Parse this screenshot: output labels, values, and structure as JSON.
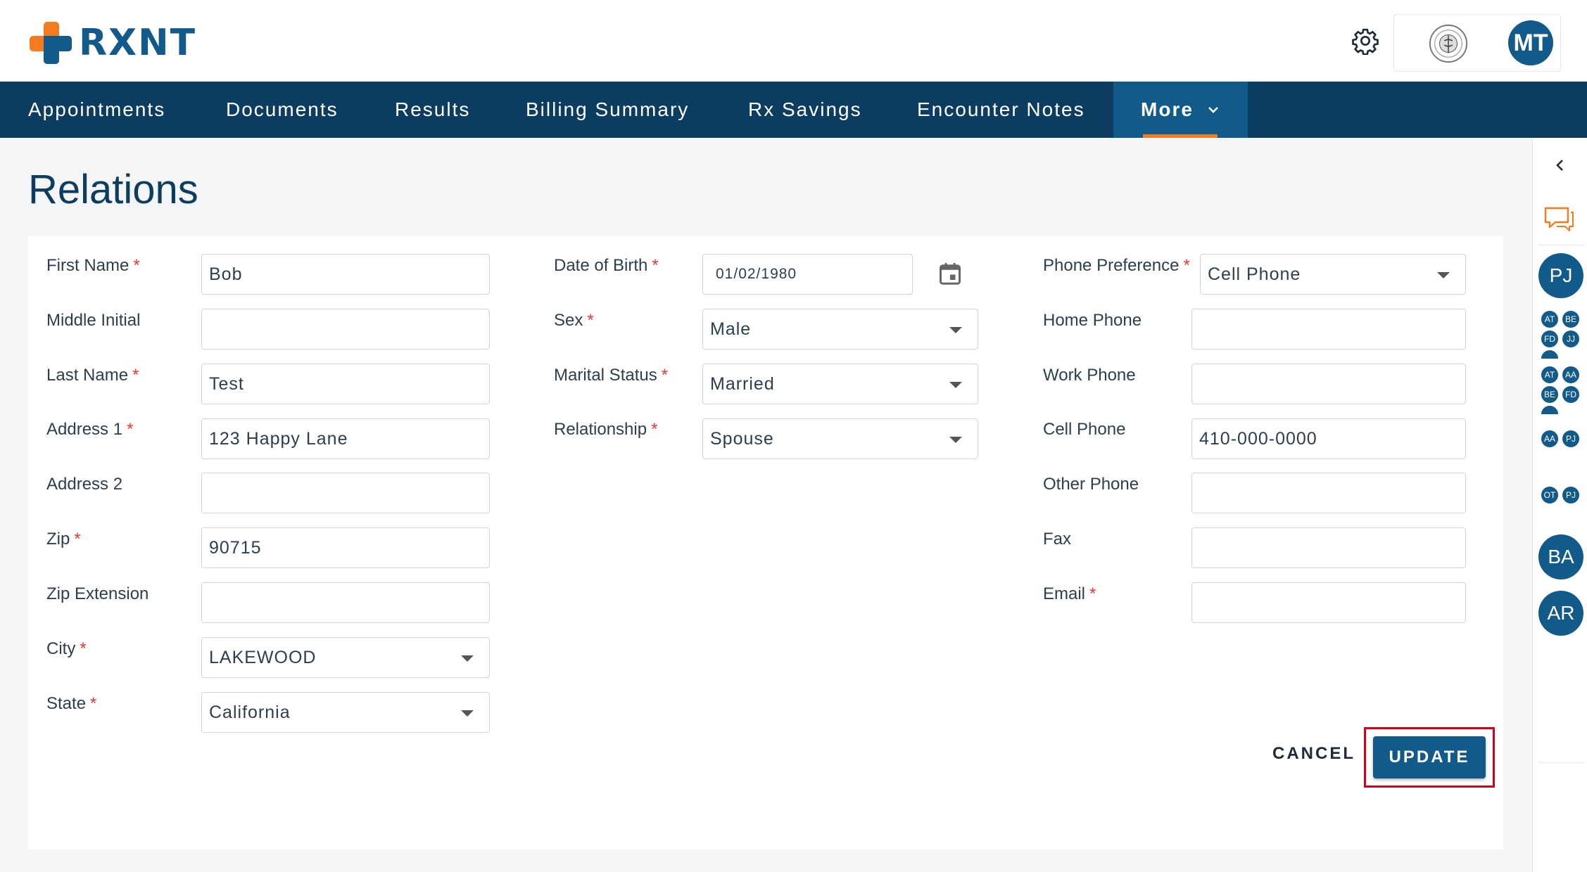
{
  "header": {
    "logo_text": "RXNT",
    "user_initials": "MT",
    "brand_colors": {
      "primary": "#115a8a",
      "nav": "#0c3d60",
      "accent": "#f47b20",
      "required": "#e53935",
      "highlight": "#d0021b"
    }
  },
  "nav": {
    "items": [
      "Appointments",
      "Documents",
      "Results",
      "Billing Summary",
      "Rx Savings",
      "Encounter Notes"
    ],
    "more_label": "More"
  },
  "page": {
    "title": "Relations"
  },
  "form": {
    "col1": [
      {
        "label": "First Name",
        "required": true,
        "value": "Bob",
        "type": "text"
      },
      {
        "label": "Middle Initial",
        "required": false,
        "value": "",
        "type": "text"
      },
      {
        "label": "Last Name",
        "required": true,
        "value": "Test",
        "type": "text"
      },
      {
        "label": "Address 1",
        "required": true,
        "value": "123 Happy Lane",
        "type": "text"
      },
      {
        "label": "Address 2",
        "required": false,
        "value": "",
        "type": "text"
      },
      {
        "label": "Zip",
        "required": true,
        "value": "90715",
        "type": "text"
      },
      {
        "label": "Zip Extension",
        "required": false,
        "value": "",
        "type": "text"
      },
      {
        "label": "City",
        "required": true,
        "value": "LAKEWOOD",
        "type": "select"
      },
      {
        "label": "State",
        "required": true,
        "value": "California",
        "type": "select"
      }
    ],
    "col2": [
      {
        "label": "Date of Birth",
        "required": true,
        "value": "01/02/1980",
        "type": "date"
      },
      {
        "label": "Sex",
        "required": true,
        "value": "Male",
        "type": "select"
      },
      {
        "label": "Marital Status",
        "required": true,
        "value": "Married",
        "type": "select"
      },
      {
        "label": "Relationship",
        "required": true,
        "value": "Spouse",
        "type": "select"
      }
    ],
    "col3": [
      {
        "label": "Phone Preference",
        "required": true,
        "value": "Cell Phone",
        "type": "select"
      },
      {
        "label": "Home Phone",
        "required": false,
        "value": "",
        "type": "text"
      },
      {
        "label": "Work Phone",
        "required": false,
        "value": "",
        "type": "text"
      },
      {
        "label": "Cell Phone",
        "required": false,
        "value": "410-000-0000",
        "type": "text"
      },
      {
        "label": "Other Phone",
        "required": false,
        "value": "",
        "type": "text"
      },
      {
        "label": "Fax",
        "required": false,
        "value": "",
        "type": "text"
      },
      {
        "label": "Email",
        "required": true,
        "value": "",
        "type": "text"
      }
    ],
    "required_mark": "*",
    "cancel_label": "CANCEL",
    "update_label": "UPDATE"
  },
  "side_panel": {
    "icons": [
      "chevron-left-icon",
      "chat-icon"
    ],
    "avatars": [
      {
        "kind": "single",
        "initials": "PJ"
      },
      {
        "kind": "group",
        "initials": [
          "AT",
          "BE",
          "FD",
          "JJ"
        ]
      },
      {
        "kind": "group",
        "initials": [
          "AT",
          "AA",
          "BE",
          "FD"
        ]
      },
      {
        "kind": "pair",
        "initials": [
          "AA",
          "PJ"
        ]
      },
      {
        "kind": "pair",
        "initials": [
          "OT",
          "PJ"
        ]
      },
      {
        "kind": "single",
        "initials": "BA"
      },
      {
        "kind": "single",
        "initials": "AR"
      }
    ]
  }
}
